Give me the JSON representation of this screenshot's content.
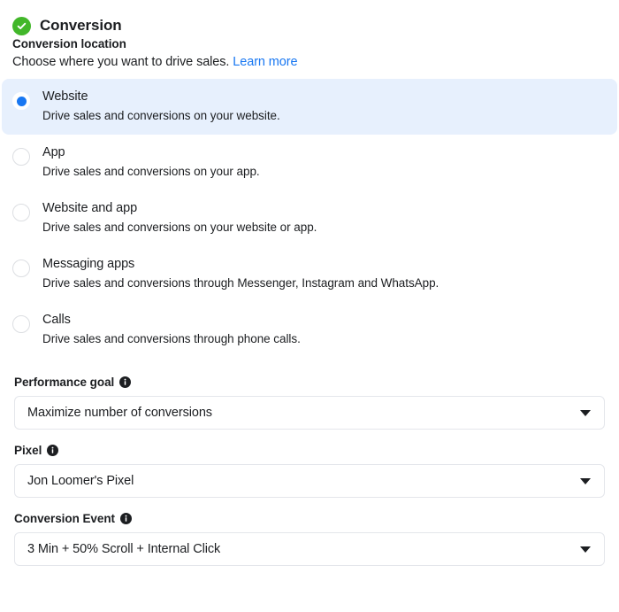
{
  "section": {
    "title": "Conversion",
    "status_icon": "check-circle-icon"
  },
  "conversion_location": {
    "label": "Conversion location",
    "description_text": "Choose where you want to drive sales.",
    "learn_more_label": "Learn more",
    "options": [
      {
        "title": "Website",
        "description": "Drive sales and conversions on your website.",
        "selected": true
      },
      {
        "title": "App",
        "description": "Drive sales and conversions on your app.",
        "selected": false
      },
      {
        "title": "Website and app",
        "description": "Drive sales and conversions on your website or app.",
        "selected": false
      },
      {
        "title": "Messaging apps",
        "description": "Drive sales and conversions through Messenger, Instagram and WhatsApp.",
        "selected": false
      },
      {
        "title": "Calls",
        "description": "Drive sales and conversions through phone calls.",
        "selected": false
      }
    ]
  },
  "performance_goal": {
    "label": "Performance goal",
    "info_icon": "info-icon",
    "value": "Maximize number of conversions",
    "caret_icon": "caret-down-icon"
  },
  "pixel": {
    "label": "Pixel",
    "info_icon": "info-icon",
    "value": "Jon Loomer's Pixel",
    "caret_icon": "caret-down-icon"
  },
  "conversion_event": {
    "label": "Conversion Event",
    "info_icon": "info-icon",
    "value": "3 Min + 50% Scroll + Internal Click",
    "caret_icon": "caret-down-icon"
  },
  "colors": {
    "accent_blue": "#1877f2",
    "success_green": "#42b72a",
    "selected_row_bg": "#e7f0fd",
    "text": "#1c1e21",
    "border": "#e4e6eb"
  }
}
